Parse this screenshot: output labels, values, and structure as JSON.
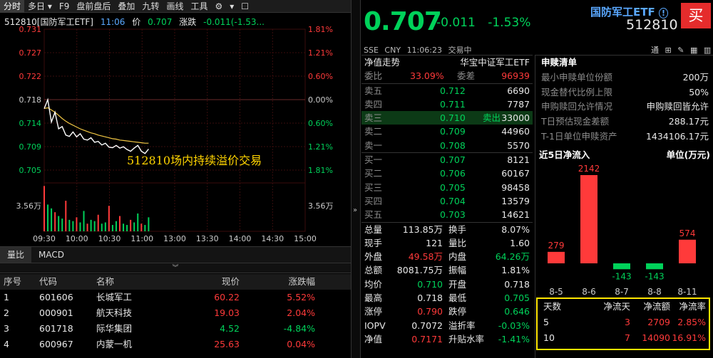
{
  "toolbar": {
    "items": [
      {
        "label": "分时",
        "active": true
      },
      {
        "label": "多日 ▾",
        "active": false
      },
      {
        "label": "F9",
        "active": false
      },
      {
        "label": "盘前盘后",
        "active": false
      },
      {
        "label": "叠加",
        "active": false
      },
      {
        "label": "九转",
        "active": false
      },
      {
        "label": "画线",
        "active": false
      },
      {
        "label": "工具",
        "active": false
      }
    ],
    "gear": "⚙"
  },
  "chart_header": {
    "code_name": "512810[国防军工ETF]",
    "time": "11:06",
    "price_label": "价",
    "price": "0.707",
    "change_label": "涨跌",
    "change": "-0.011(-1.53..."
  },
  "chart_data": {
    "type": "line",
    "title": "512810[国防军工ETF]",
    "ylim": [
      0.7023,
      0.7337
    ],
    "prev_close": 0.718,
    "price_ticks": [
      "0.731",
      "0.727",
      "0.722",
      "0.718",
      "0.714",
      "0.709",
      "0.705"
    ],
    "pct_ticks": [
      "1.81%",
      "1.21%",
      "0.60%",
      "0.00%",
      "0.60%",
      "1.21%",
      "1.81%"
    ],
    "volume_label": "3.56万",
    "x_ticks": [
      "09:30",
      "10:00",
      "10:30",
      "11:00",
      "13:00",
      "13:30",
      "14:00",
      "14:30",
      "15:00"
    ],
    "annotation": "512810场内持续溢价交易",
    "series": [
      {
        "name": "price",
        "color": "#ffffff",
        "values": [
          0.716,
          0.718,
          0.713,
          0.7152,
          0.7115,
          0.712,
          0.7101,
          0.7098,
          0.7108,
          0.7097,
          0.7104,
          0.7092,
          0.709,
          0.7095,
          0.7085,
          0.7087,
          0.7079,
          0.7083,
          0.7074,
          0.7073,
          0.7078,
          0.7072,
          0.7075,
          0.7069,
          0.7065,
          0.7072,
          0.7078,
          0.7065,
          0.706,
          0.707
        ]
      },
      {
        "name": "avg",
        "color": "#f2c744",
        "values": [
          0.716,
          0.7162,
          0.7157,
          0.7152,
          0.7145,
          0.7138,
          0.7132,
          0.7127,
          0.7123,
          0.7119,
          0.7115,
          0.7112,
          0.7109,
          0.7106,
          0.7104,
          0.7101,
          0.7099,
          0.7097,
          0.7095,
          0.7093,
          0.7092,
          0.709,
          0.7089,
          0.7088,
          0.7087,
          0.7086,
          0.7085,
          0.7084,
          0.7083,
          0.7083
        ]
      }
    ],
    "volume": [
      3.56,
      2.1,
      1.8,
      1.5,
      1.2,
      1.0,
      2.4,
      0.9,
      0.8,
      1.1,
      0.7,
      1.6,
      0.6,
      0.9,
      0.8,
      1.3,
      0.6,
      0.7,
      2.0,
      0.5,
      0.8,
      1.2,
      0.6,
      0.5,
      0.9,
      0.7,
      1.4,
      0.6,
      0.5,
      1.1
    ],
    "volume_max": 3.8
  },
  "indicator_tabs": [
    "量比",
    "MACD"
  ],
  "stock_list": {
    "headers": [
      "序号",
      "代码",
      "名称",
      "现价",
      "涨跌幅"
    ],
    "rows": [
      {
        "n": "1",
        "code": "601606",
        "name": "长城军工",
        "price": "60.22",
        "pct": "5.52%",
        "dir": "up"
      },
      {
        "n": "2",
        "code": "000901",
        "name": "航天科技",
        "price": "19.03",
        "pct": "2.04%",
        "dir": "up"
      },
      {
        "n": "3",
        "code": "601718",
        "name": "际华集团",
        "price": "4.52",
        "pct": "-4.84%",
        "dir": "down"
      },
      {
        "n": "4",
        "code": "600967",
        "name": "内蒙一机",
        "price": "25.63",
        "pct": "0.04%",
        "dir": "up"
      }
    ]
  },
  "quote": {
    "price": "0.707",
    "change": "-0.011",
    "change_pct": "-1.53%",
    "name": "国防军工ETF",
    "code": "512810",
    "buy": "买",
    "info": [
      "SSE",
      "CNY",
      "11:06:23",
      "交易中"
    ],
    "icons": [
      "通",
      "⊞",
      "✎",
      "▦",
      "▥",
      "▤"
    ]
  },
  "orderbook": {
    "title": "净值走势",
    "tracker": "华宝中证军工ETF",
    "weibi_label": "委比",
    "weibi": "33.09%",
    "weicha_label": "委差",
    "weicha": "96939",
    "asks": [
      {
        "label": "卖五",
        "price": "0.712",
        "vol": "6690"
      },
      {
        "label": "卖四",
        "price": "0.711",
        "vol": "7787"
      },
      {
        "label": "卖三",
        "price": "0.710",
        "vol": "33000",
        "tag": "卖出"
      },
      {
        "label": "卖二",
        "price": "0.709",
        "vol": "44960"
      },
      {
        "label": "卖一",
        "price": "0.708",
        "vol": "5570"
      }
    ],
    "bids": [
      {
        "label": "买一",
        "price": "0.707",
        "vol": "8121"
      },
      {
        "label": "买二",
        "price": "0.706",
        "vol": "60167"
      },
      {
        "label": "买三",
        "price": "0.705",
        "vol": "98458"
      },
      {
        "label": "买四",
        "price": "0.704",
        "vol": "13579"
      },
      {
        "label": "买五",
        "price": "0.703",
        "vol": "14621"
      }
    ],
    "stats": [
      {
        "l1": "总量",
        "v1": "113.85万",
        "c1": "wht",
        "l2": "换手",
        "v2": "8.07%",
        "c2": "wht"
      },
      {
        "l1": "现手",
        "v1": "121",
        "c1": "wht",
        "l2": "量比",
        "v2": "1.60",
        "c2": "wht"
      },
      {
        "l1": "外盘",
        "v1": "49.58万",
        "c1": "red",
        "l2": "内盘",
        "v2": "64.26万",
        "c2": "grn"
      },
      {
        "l1": "总额",
        "v1": "8081.75万",
        "c1": "wht",
        "l2": "振幅",
        "v2": "1.81%",
        "c2": "wht"
      },
      {
        "l1": "均价",
        "v1": "0.710",
        "c1": "grn",
        "l2": "开盘",
        "v2": "0.718",
        "c2": "wht"
      },
      {
        "l1": "最高",
        "v1": "0.718",
        "c1": "wht",
        "l2": "最低",
        "v2": "0.705",
        "c2": "grn"
      },
      {
        "l1": "涨停",
        "v1": "0.790",
        "c1": "red",
        "l2": "跌停",
        "v2": "0.646",
        "c2": "grn"
      },
      {
        "l1": "IOPV",
        "v1": "0.7072",
        "c1": "wht",
        "l2": "溢折率",
        "v2": "-0.03%",
        "c2": "grn"
      },
      {
        "l1": "净值",
        "v1": "0.7171",
        "c1": "red",
        "l2": "升贴水率",
        "v2": "-1.41%",
        "c2": "grn"
      }
    ]
  },
  "purchase": {
    "title": "申赎清单",
    "rows": [
      {
        "label": "最小申赎单位份额",
        "value": "200万"
      },
      {
        "label": "现金替代比例上限",
        "value": "50%"
      },
      {
        "label": "申购赎回允许情况",
        "value": "申购赎回皆允许"
      },
      {
        "label": "T日预估现金差额",
        "value": "288.17元"
      },
      {
        "label": "T-1日单位申赎资产",
        "value": "1434106.17元"
      }
    ]
  },
  "flow": {
    "title": "近5日净流入",
    "unit": "单位(万元)",
    "chart_data": {
      "type": "bar",
      "categories": [
        "8-5",
        "8-6",
        "8-7",
        "8-8",
        "8-11"
      ],
      "values": [
        279,
        2142,
        -143,
        -143,
        574
      ]
    },
    "summary_headers": [
      "天数",
      "净流天",
      "净流额",
      "净流率"
    ],
    "summary_rows": [
      {
        "days": "5",
        "nd": "3",
        "amt": "2709",
        "rate": "2.85%"
      },
      {
        "days": "10",
        "nd": "7",
        "amt": "14090",
        "rate": "16.91%"
      }
    ]
  }
}
